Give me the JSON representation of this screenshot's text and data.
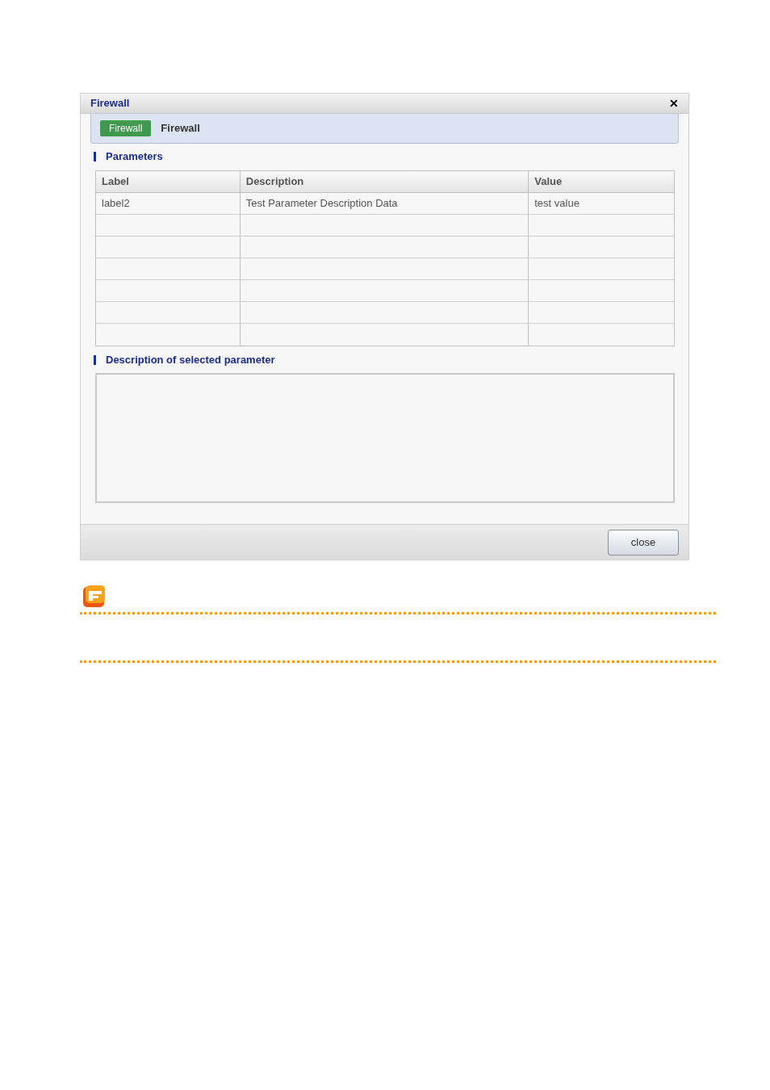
{
  "window": {
    "title": "Firewall",
    "close_glyph": "✕"
  },
  "header": {
    "badge": "Firewall",
    "title": "Firewall"
  },
  "parameters": {
    "heading": "Parameters",
    "columns": [
      "Label",
      "Description",
      "Value"
    ],
    "rows": [
      [
        "label2",
        "Test Parameter Description Data",
        "test value"
      ]
    ]
  },
  "description": {
    "heading": "Description of selected parameter"
  },
  "buttons": [
    "close"
  ]
}
